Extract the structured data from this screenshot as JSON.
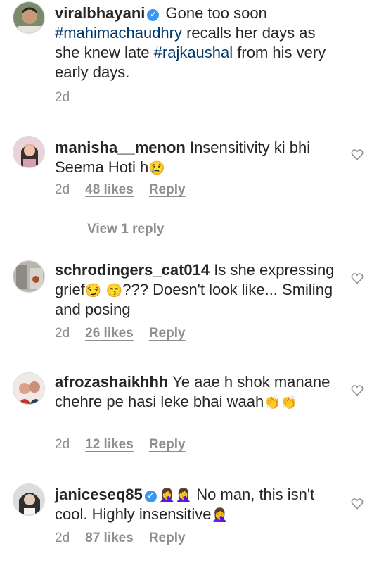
{
  "post": {
    "username": "viralbhayani",
    "text_before": " Gone too soon ",
    "tag1": "#mahimachaudhry",
    "text_middle": " recalls her days as she knew late ",
    "tag2": "#rajkaushal",
    "text_after": " from his very early days.",
    "time": "2d"
  },
  "comments": [
    {
      "username": "manisha__menon",
      "text": " Insensitivity ki bhi Seema Hoti h",
      "emoji": "😢",
      "time": "2d",
      "likes": "48 likes",
      "reply": "Reply"
    },
    {
      "username": "schrodingers_cat014",
      "text_a": " Is she expressing grief",
      "emoji_a": "😏",
      "emoji_b": "😙",
      "text_b": "??? Doesn't look like... Smiling and posing",
      "time": "2d",
      "likes": "26 likes",
      "reply": "Reply"
    },
    {
      "username": "afrozashaikhhh",
      "text": " Ye aae h shok manane chehre pe hasi leke bhai waah",
      "emoji": "👏👏",
      "time": "2d",
      "likes": "12 likes",
      "reply": "Reply"
    },
    {
      "username": "janiceseq85",
      "emoji_a": "🤦‍♀️🤦‍♀️",
      "text": " No man, this isn't cool. Highly insensitive",
      "emoji_b": "🤦‍♀️",
      "time": "2d",
      "likes": "87 likes",
      "reply": "Reply"
    }
  ],
  "view_reply": "View 1 reply",
  "colors": {
    "text": "#262626",
    "meta": "#8e8e8e",
    "link": "#00376b",
    "verified": "#3897f0"
  },
  "icons": {
    "like": "heart-outline-icon",
    "verified": "verified-badge-icon"
  }
}
